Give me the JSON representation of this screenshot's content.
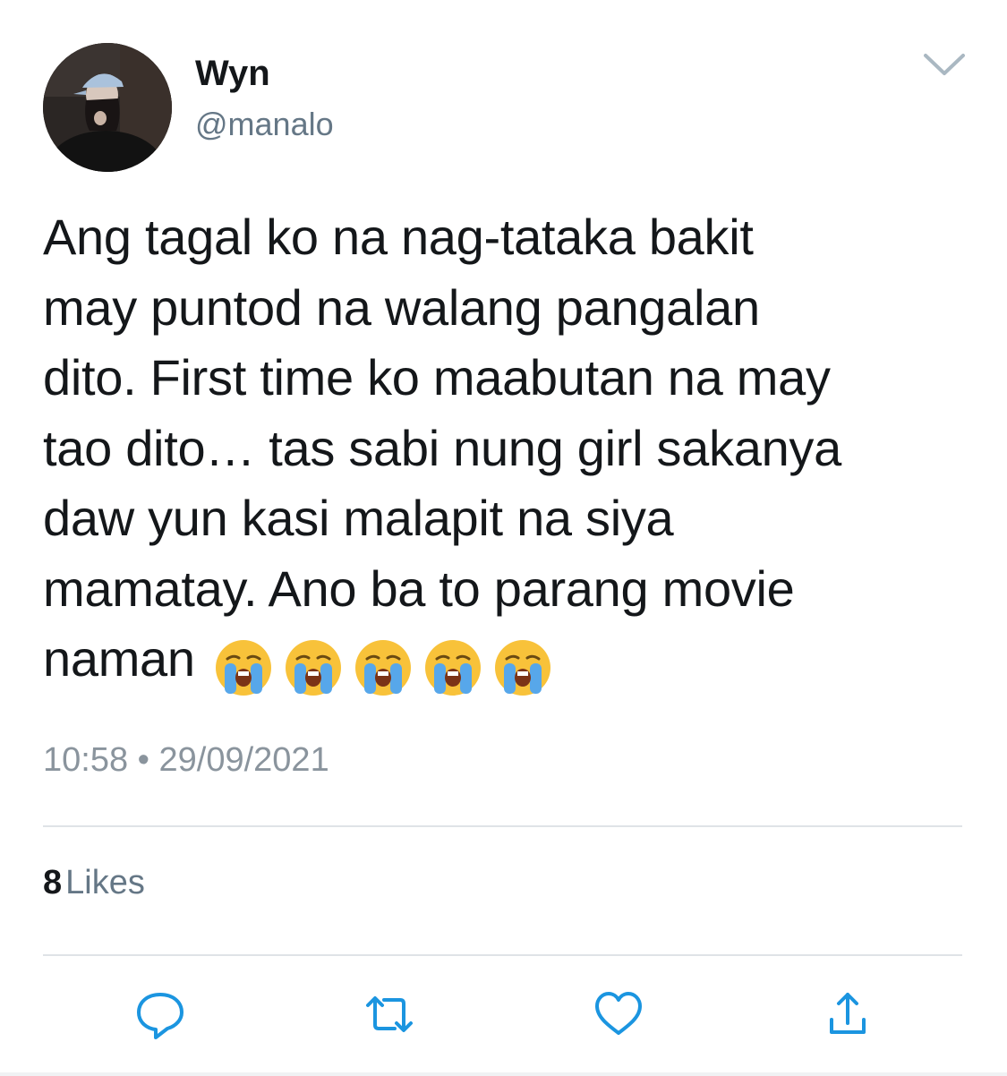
{
  "author": {
    "name": "Wyn",
    "handle": "@manalo"
  },
  "tweet": {
    "text": "Ang tagal ko na nag-tataka bakit\nmay puntod na walang pangalan\ndito. First time ko maabutan na may\ntao dito… tas sabi nung girl sakanya\ndaw yun kasi malapit na siya\nmamatay. Ano ba to parang movie\nnaman",
    "emoji": [
      "😭",
      "😭",
      "😭",
      "😭",
      "😭"
    ],
    "timestamp": "10:58 • 29/09/2021"
  },
  "stats": {
    "likes_count": "8",
    "likes_label": "Likes"
  },
  "icons": {
    "menu": "chevron-down-icon",
    "reply": "reply-icon",
    "retweet": "retweet-icon",
    "like": "heart-icon",
    "share": "share-icon"
  },
  "colors": {
    "primary_text": "#14171a",
    "secondary_text": "#657786",
    "icon_blue": "#1b95e0",
    "divider": "#dfe3e7"
  }
}
